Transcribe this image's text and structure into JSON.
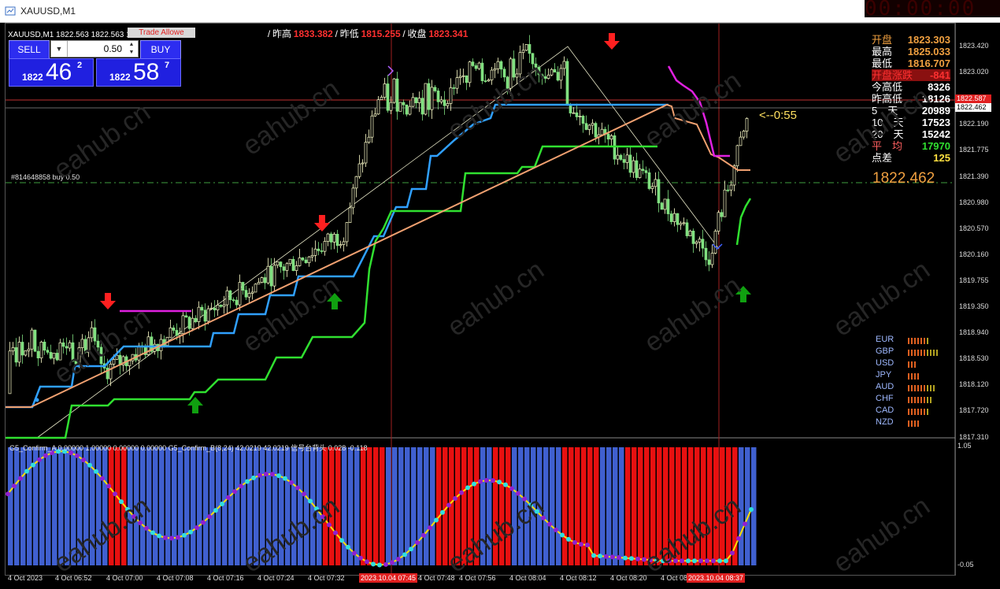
{
  "window": {
    "title": "XAUUSD,M1",
    "clock_text": "00:00:00"
  },
  "header": {
    "symbol": "XAUUSD,M1",
    "ohlc": "1822.563 1822.563 1822.433 1822.462",
    "overlay_badge": "Trade Allowe",
    "sep1": "/",
    "yesterday_high_label": "昨高",
    "yesterday_high": "1833.382",
    "sep2": "/",
    "yesterday_low_label": "昨低",
    "yesterday_low": "1815.255",
    "sep3": "/",
    "close_label": "收盘",
    "close": "1823.341"
  },
  "trade_panel": {
    "sell_label": "SELL",
    "buy_label": "BUY",
    "lot": "0.50",
    "lot_dropdown_icon": "chevron-down-icon",
    "sell_small": "1822",
    "sell_big": "46",
    "sell_sup": "2",
    "buy_small": "1822",
    "buy_big": "58",
    "buy_sup": "7"
  },
  "stats": [
    {
      "k": "开盘",
      "v": "1823.303",
      "color": "#f0a040",
      "vcolor": "#f0a040"
    },
    {
      "k": "最高",
      "v": "1825.033",
      "color": "#ffffff",
      "vcolor": "#f0a040"
    },
    {
      "k": "最低",
      "v": "1816.707",
      "color": "#ffffff",
      "vcolor": "#f0a040"
    },
    {
      "k": "开盘涨跌",
      "v": "-841",
      "color": "#ff3030",
      "vcolor": "#ff3030"
    },
    {
      "k": "今高低",
      "v": "8326",
      "color": "#ffffff",
      "vcolor": "#ffffff"
    },
    {
      "k": "昨高低",
      "v": "18126",
      "color": "#ffffff",
      "vcolor": "#ffffff"
    },
    {
      "k": "5　天",
      "v": "20989",
      "color": "#ffffff",
      "vcolor": "#ffffff"
    },
    {
      "k": "10　天",
      "v": "17523",
      "color": "#ffffff",
      "vcolor": "#ffffff"
    },
    {
      "k": "20　天",
      "v": "15242",
      "color": "#ffffff",
      "vcolor": "#ffffff"
    },
    {
      "k": "平　均",
      "v": "17970",
      "color": "#ff6060",
      "vcolor": "#30e030"
    },
    {
      "k": "点差",
      "v": "125",
      "color": "#ffffff",
      "vcolor": "#ffe040"
    }
  ],
  "current_price": "1822.462",
  "countdown": "<--0:55",
  "order_label": "#814648858 buy 0.50",
  "indicator_header": "G5_Confirm_A 0.00000 1.00000 0.00000 0.00000  G5_Confirm_B(8,24) 42.0219 42.0219  信号台背头 0.028 -0.118",
  "price_axis": [
    "1823.420",
    "1823.020",
    "1822.605",
    "1822.190",
    "1821.775",
    "1821.390",
    "1820.980",
    "1820.570",
    "1820.160",
    "1819.755",
    "1819.350",
    "1818.940",
    "1818.530",
    "1818.120",
    "1817.720",
    "1817.310"
  ],
  "price_tags": [
    {
      "text": "1822.587",
      "bg": "#e02020",
      "fg": "#ffffff"
    },
    {
      "text": "1822.462",
      "bg": "#ffffff",
      "fg": "#000000"
    }
  ],
  "indicator_scale": {
    "top": "1.05",
    "bottom": "-0.05"
  },
  "time_axis": [
    "4 Oct 2023",
    "4 Oct 06:52",
    "4 Oct 07:00",
    "4 Oct 07:08",
    "4 Oct 07:16",
    "4 Oct 07:24",
    "4 Oct 07:32",
    "4 Oct 07:48",
    "4 Oct 07:56",
    "4 Oct 08:04",
    "4 Oct 08:12",
    "4 Oct 08:20",
    "4 Oct 08"
  ],
  "time_tags": [
    "2023.10.04 07:45",
    "2023.10.04 08:37"
  ],
  "currencies": [
    {
      "name": "EUR",
      "bars": 7
    },
    {
      "name": "GBP",
      "bars": 10
    },
    {
      "name": "USD",
      "bars": 3
    },
    {
      "name": "JPY",
      "bars": 4
    },
    {
      "name": "AUD",
      "bars": 9
    },
    {
      "name": "CHF",
      "bars": 8
    },
    {
      "name": "CAD",
      "bars": 7
    },
    {
      "name": "NZD",
      "bars": 4
    }
  ],
  "watermark": "eahub.cn",
  "colors": {
    "bull": "#ffffcc",
    "bear": "#80e080",
    "blue_line": "#30a0ff",
    "green_line": "#30e030",
    "orange_line": "#f0a070",
    "magenta_line": "#e020e0",
    "red_arrow": "#ff2020",
    "green_arrow": "#10a010"
  }
}
